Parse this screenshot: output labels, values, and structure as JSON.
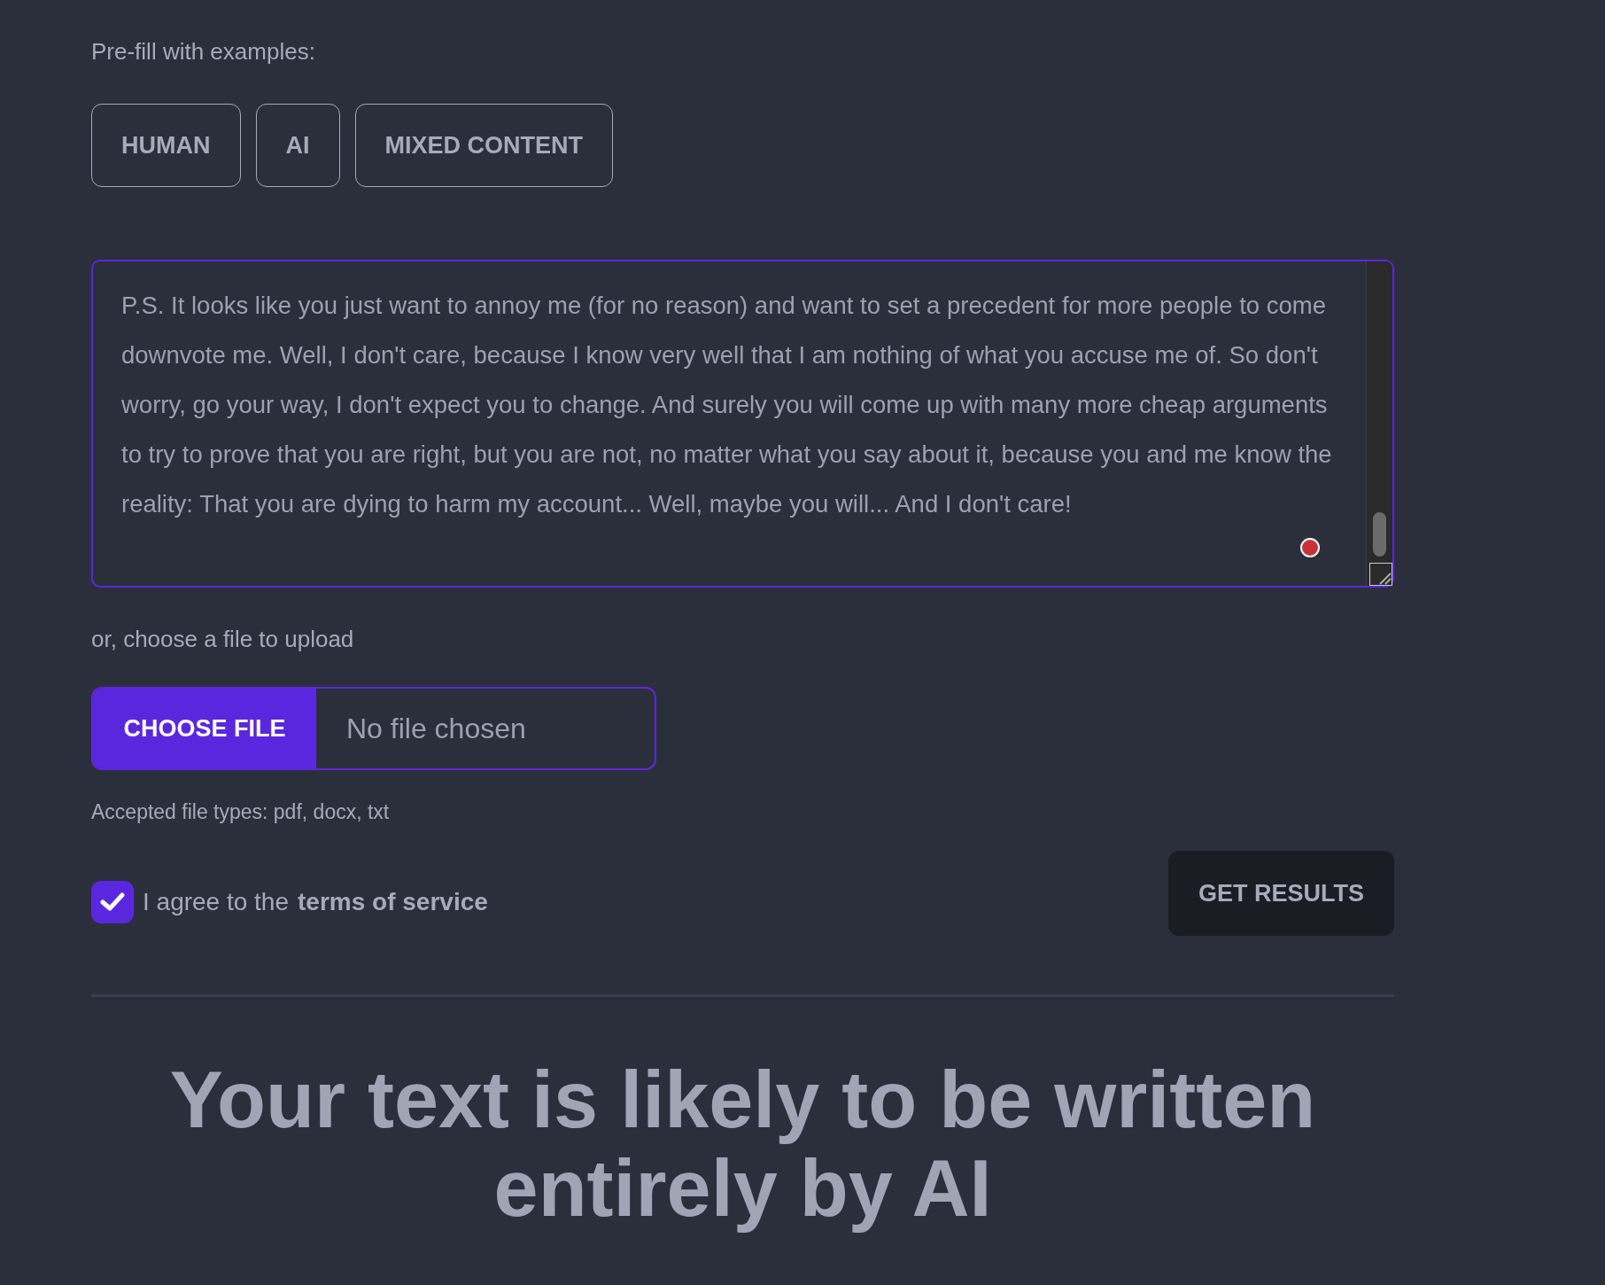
{
  "prefill": {
    "label": "Pre-fill with examples:",
    "buttons": [
      "HUMAN",
      "AI",
      "MIXED CONTENT"
    ]
  },
  "text_input": {
    "value": "P.S. It looks like you just want to annoy me (for no reason) and want to set a precedent for more people to come downvote me. Well, I don't care, because I know very well that I am nothing of what you accuse me of. So don't worry, go your way, I don't expect you to change. And surely you will come up with many more cheap arguments to try to prove that you are right, but you are not, no matter what you say about it, because you and me know the reality: That you are dying to harm my account... Well, maybe you will... And I don't care!"
  },
  "upload": {
    "label": "or, choose a file to upload",
    "button": "CHOOSE FILE",
    "status": "No file chosen",
    "hint": "Accepted file types: pdf, docx, txt"
  },
  "terms": {
    "checked": true,
    "label": "I agree to the",
    "link": "terms of service"
  },
  "submit_button": "GET RESULTS",
  "result_heading": "Your text is likely to be written entirely by AI"
}
